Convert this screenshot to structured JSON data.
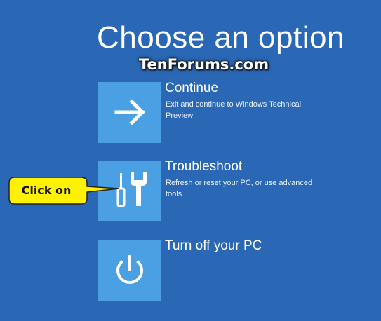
{
  "screen": {
    "title": "Choose an option",
    "watermark": "TenForums.com"
  },
  "options": [
    {
      "title": "Continue",
      "description": "Exit and continue to Windows Technical Preview",
      "icon": "arrow-right-icon"
    },
    {
      "title": "Troubleshoot",
      "description": "Refresh or reset your PC, or use advanced tools",
      "icon": "screwdriver-wrench-icon"
    },
    {
      "title": "Turn off your PC",
      "description": "",
      "icon": "power-icon"
    }
  ],
  "callout": {
    "label": "Click on"
  },
  "colors": {
    "background": "#2a68b6",
    "tile": "#4aa0e3",
    "callout_fill": "#fff200"
  }
}
